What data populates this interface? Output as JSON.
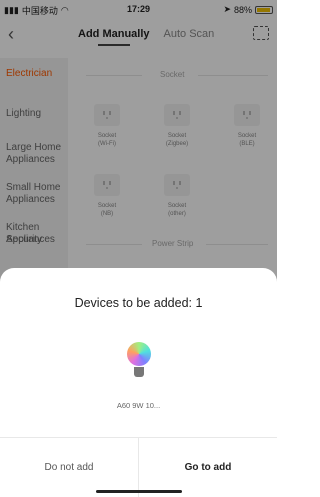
{
  "status_bar": {
    "carrier": "中国移动",
    "time": "17:29",
    "battery": "88%"
  },
  "nav": {
    "tabs": [
      "Add Manually",
      "Auto Scan"
    ]
  },
  "sidebar": {
    "items": [
      "Electrician",
      "Lighting",
      "Large Home Appliances",
      "Small Home Appliances",
      "Kitchen Appliances",
      "Security"
    ]
  },
  "content": {
    "section_socket": "Socket",
    "section_power_strip": "Power Strip",
    "devices": [
      {
        "name": "Socket",
        "sub": "(Wi-Fi)"
      },
      {
        "name": "Socket",
        "sub": "(Zigbee)"
      },
      {
        "name": "Socket",
        "sub": "(BLE)"
      },
      {
        "name": "Socket",
        "sub": "(NB)"
      },
      {
        "name": "Socket",
        "sub": "(other)"
      }
    ]
  },
  "dialog": {
    "title": "Devices to be added: 1",
    "device_label": "A60 9W 10...",
    "cancel_label": "Do not add",
    "confirm_label": "Go to add"
  },
  "colors": {
    "accent": "#ff5a00"
  }
}
